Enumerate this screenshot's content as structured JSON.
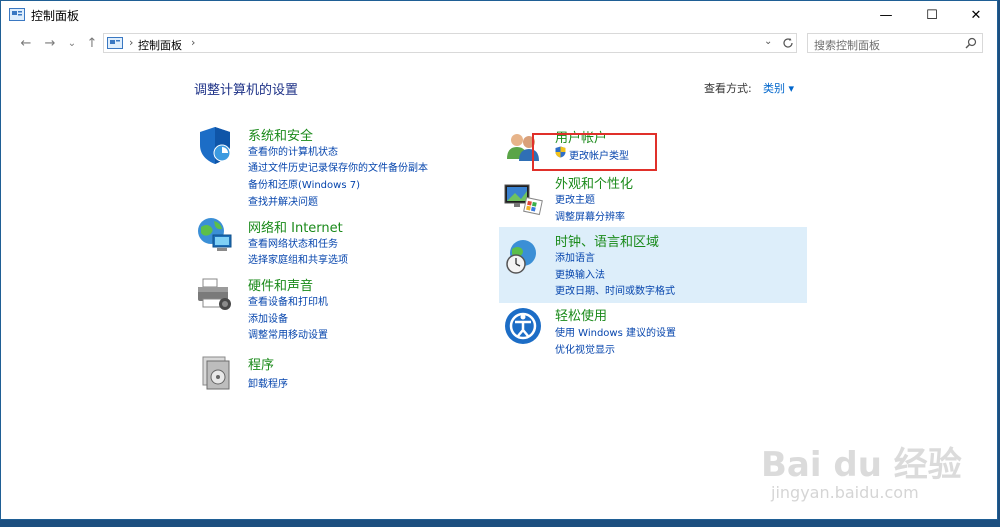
{
  "window": {
    "title": "控制面板",
    "minimize": "—",
    "maximize": "☐",
    "close": "✕"
  },
  "nav": {
    "back": "←",
    "forward": "→",
    "dropdown": "⌄",
    "up": "↑"
  },
  "address": {
    "separator": "›",
    "path": "控制面板",
    "separator_after": "›"
  },
  "search": {
    "placeholder": "搜索控制面板"
  },
  "main": {
    "heading": "调整计算机的设置",
    "view_by_label": "查看方式:",
    "view_by_value": "类别 ▾"
  },
  "categories": {
    "system": {
      "title": "系统和安全",
      "links": [
        "查看你的计算机状态",
        "通过文件历史记录保存你的文件备份副本",
        "备份和还原(Windows 7)",
        "查找并解决问题"
      ]
    },
    "network": {
      "title": "网络和 Internet",
      "links": [
        "查看网络状态和任务",
        "选择家庭组和共享选项"
      ]
    },
    "hardware": {
      "title": "硬件和声音",
      "links": [
        "查看设备和打印机",
        "添加设备",
        "调整常用移动设置"
      ]
    },
    "programs": {
      "title": "程序",
      "links": [
        "卸载程序"
      ]
    },
    "accounts": {
      "title": "用户帐户",
      "links": [
        "更改帐户类型"
      ]
    },
    "appearance": {
      "title": "外观和个性化",
      "links": [
        "更改主题",
        "调整屏幕分辨率"
      ]
    },
    "clock": {
      "title": "时钟、语言和区域",
      "links": [
        "添加语言",
        "更换输入法",
        "更改日期、时间或数字格式"
      ]
    },
    "ease": {
      "title": "轻松使用",
      "links": [
        "使用 Windows 建议的设置",
        "优化视觉显示"
      ]
    }
  },
  "watermark": {
    "main": "Bai du 经验",
    "sub": "jingyan.baidu.com"
  }
}
